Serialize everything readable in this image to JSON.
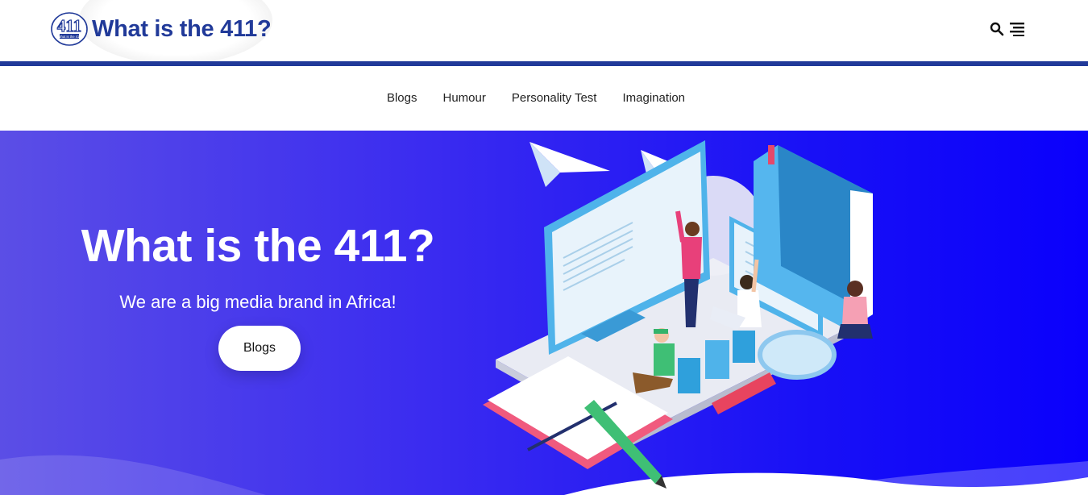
{
  "header": {
    "site_title": "What is the 411?",
    "logo": {
      "numerals": "411",
      "tagline": "What is the 411"
    },
    "icons": {
      "search": "search-icon",
      "menu": "menu-icon"
    }
  },
  "nav": {
    "items": [
      {
        "label": "Blogs"
      },
      {
        "label": "Humour"
      },
      {
        "label": "Personality Test"
      },
      {
        "label": "Imagination"
      }
    ]
  },
  "hero": {
    "title": "What is the 411?",
    "subtitle": "We are a big media brand in Africa!",
    "button_label": "Blogs"
  },
  "colors": {
    "brand_blue": "#213a99",
    "hero_gradient_start": "#5b4ee6",
    "hero_gradient_end": "#0a00fc",
    "white": "#ffffff"
  }
}
